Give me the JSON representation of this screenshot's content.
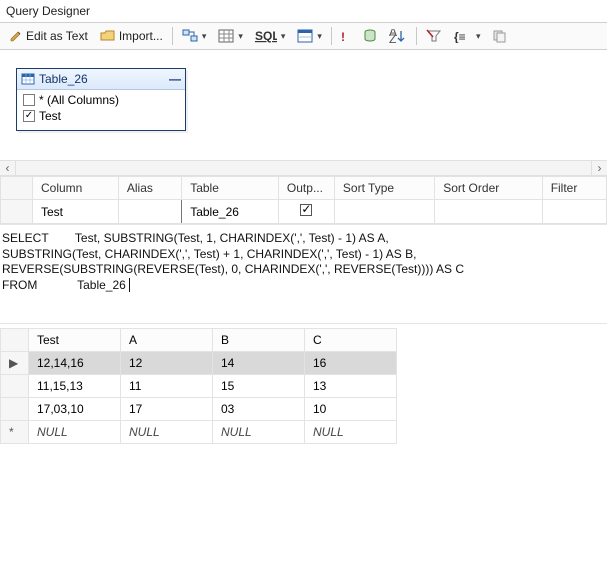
{
  "window": {
    "title": "Query Designer"
  },
  "toolbar": {
    "edit_as_text": "Edit as Text",
    "import": "Import..."
  },
  "diagram": {
    "table_name": "Table_26",
    "columns": [
      {
        "label": "* (All Columns)",
        "checked": false
      },
      {
        "label": "Test",
        "checked": true
      }
    ]
  },
  "criteria": {
    "headers": [
      "Column",
      "Alias",
      "Table",
      "Outp...",
      "Sort Type",
      "Sort Order",
      "Filter"
    ],
    "row": {
      "column": "Test",
      "alias": "",
      "table": "Table_26"
    }
  },
  "sql": {
    "line1": "SELECT        Test, SUBSTRING(Test, 1, CHARINDEX(',', Test) - 1) AS A,",
    "line2": "SUBSTRING(Test, CHARINDEX(',', Test) + 1, CHARINDEX(',', Test) - 1) AS B,",
    "line3": "REVERSE(SUBSTRING(REVERSE(Test), 0, CHARINDEX(',', REVERSE(Test)))) AS C",
    "line4": "FROM            Table_26"
  },
  "results": {
    "headers": [
      "Test",
      "A",
      "B",
      "C"
    ],
    "rows": [
      {
        "marker": "▶",
        "selected": true,
        "cells": [
          "12,14,16",
          "12",
          "14",
          "16"
        ]
      },
      {
        "marker": "",
        "selected": false,
        "cells": [
          "11,15,13",
          "11",
          "15",
          "13"
        ]
      },
      {
        "marker": "",
        "selected": false,
        "cells": [
          "17,03,10",
          "17",
          "03",
          "10"
        ]
      },
      {
        "marker": "*",
        "selected": false,
        "cells": [
          "NULL",
          "NULL",
          "NULL",
          "NULL"
        ],
        "null": true
      }
    ]
  }
}
